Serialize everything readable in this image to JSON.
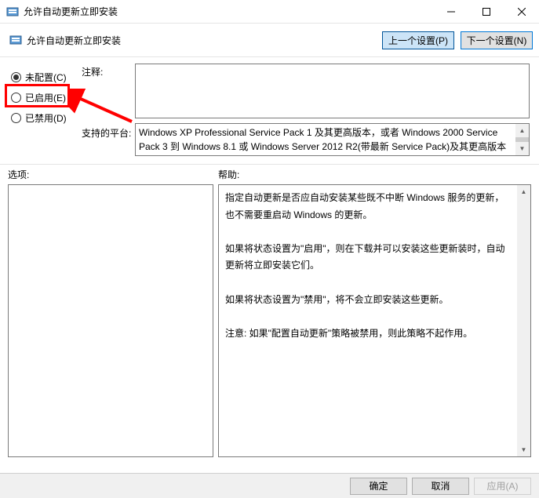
{
  "window": {
    "title": "允许自动更新立即安装"
  },
  "header": {
    "title": "允许自动更新立即安装",
    "prev_btn": "上一个设置(P)",
    "next_btn": "下一个设置(N)"
  },
  "radios": {
    "not_configured": "未配置(C)",
    "enabled": "已启用(E)",
    "disabled": "已禁用(D)"
  },
  "labels": {
    "comment": "注释:",
    "platform": "支持的平台:",
    "options": "选项:",
    "help": "帮助:"
  },
  "platform_text": "Windows XP Professional Service Pack 1 及其更高版本，或者 Windows 2000 Service Pack 3 到 Windows 8.1 或 Windows Server 2012 R2(带最新 Service Pack)及其更高版本",
  "help_text": "指定自动更新是否应自动安装某些既不中断 Windows 服务的更新，也不需要重启动 Windows 的更新。\n\n如果将状态设置为\"启用\"，则在下载并可以安装这些更新装时，自动更新将立即安装它们。\n\n如果将状态设置为\"禁用\"，将不会立即安装这些更新。\n\n注意: 如果\"配置自动更新\"策略被禁用，则此策略不起作用。",
  "buttons": {
    "ok": "确定",
    "cancel": "取消",
    "apply": "应用(A)"
  }
}
